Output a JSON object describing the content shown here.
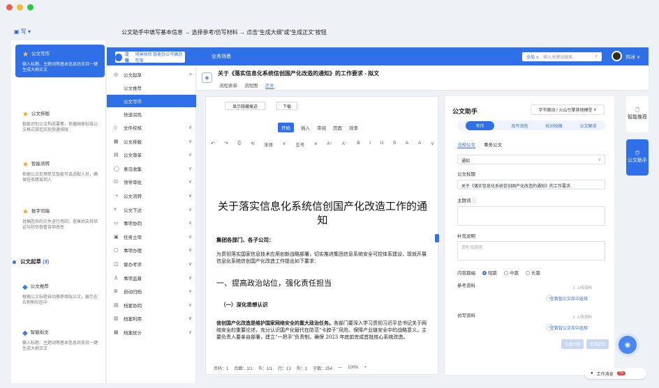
{
  "window": {
    "traffic": [
      "#ef5b52",
      "#f5bd2d",
      "#28c840"
    ]
  },
  "tip": "公文助手中填写基本信息 → 选择参考/仿写材料 → 点击“生成大纲”或“生成正文”按钮",
  "workspace": "写",
  "left_cards": [
    {
      "title": "公文写作",
      "desc": "输入标题、主题词等基本信息后支持一键生成大纲正文",
      "icon": "star-icon",
      "sel": true
    },
    {
      "title": "公文排版",
      "desc": "智能识别公文构成要素，依据国家标准公文格式规范实现快速排版",
      "icon": "star-icon"
    },
    {
      "title": "智能流转",
      "desc": "依据公文处理意见智能写选适配人员，确保任务精准到人",
      "icon": "star-icon"
    },
    {
      "title": "数字司稿",
      "desc": "对稿签后的文件进行用印，查章后支持验证与防伪查看各项改性",
      "icon": "star-icon"
    },
    {
      "title": "公文推荐",
      "desc": "根据公文标题自动推荐相似公文，展示在右侧侧栏区中",
      "icon": "drop-icon"
    },
    {
      "title": "智能拟文",
      "desc": "输入标题、主题词等基本信息后支持一键生成大纲正文",
      "icon": "drop-icon"
    }
  ],
  "section": {
    "label": "公文起草",
    "count": "(3)"
  },
  "topbar": {
    "logo": "泛微",
    "logo_sub": "场景体验 智能办公写稿办存审",
    "tab": "业务场景",
    "search_scope": "全局 ∨",
    "search_placeholder": "输入关键词搜索",
    "user": "刘冰 ∨"
  },
  "nav": [
    {
      "label": "公文起草",
      "icon": "◎",
      "ch": ">"
    },
    {
      "label": "公文推荐",
      "sub": true
    },
    {
      "label": "公文写作",
      "sub": true,
      "act": true
    },
    {
      "label": "快速润色",
      "sub": true
    },
    {
      "label": "文件校核",
      "icon": "◇",
      "ch": "∨"
    },
    {
      "label": "公文排版",
      "icon": "▦",
      "ch": "∨"
    },
    {
      "label": "公文审单",
      "icon": "▤",
      "ch": "∨"
    },
    {
      "label": "意见收集",
      "icon": "◯",
      "ch": "∨"
    },
    {
      "label": "领导审批",
      "icon": "☑",
      "ch": "∨"
    },
    {
      "label": "公文流转",
      "icon": "⇢",
      "ch": "∨"
    },
    {
      "label": "公文下达",
      "icon": "⩔",
      "ch": "∨"
    },
    {
      "label": "事项协同",
      "icon": "▭",
      "ch": "∨"
    },
    {
      "label": "任务立项",
      "icon": "▣",
      "ch": "∨"
    },
    {
      "label": "事项办理",
      "icon": "▢",
      "ch": "∨"
    },
    {
      "label": "督办考评",
      "icon": "◫",
      "ch": "∨"
    },
    {
      "label": "事项监督",
      "icon": "♙",
      "ch": "∨"
    },
    {
      "label": "自动归档",
      "icon": "⊞",
      "ch": "∨"
    },
    {
      "label": "档案协同",
      "icon": "▤",
      "ch": "∨"
    },
    {
      "label": "档案利用",
      "icon": "▥",
      "ch": "∨"
    },
    {
      "label": "档案统计",
      "icon": "▦",
      "ch": "∨"
    }
  ],
  "doc": {
    "title": "关于《落实信息化系统信创国产化改造的通知》的工作要求 - 拟文",
    "tabs": [
      "流程表单",
      "流程图",
      "正文"
    ]
  },
  "editor": {
    "btn1": "显示隐藏痕迹",
    "btn2": "下载",
    "ribbon": [
      "开始",
      "插入",
      "审阅",
      "页面",
      "效率"
    ],
    "fmt": [
      "↶",
      "↷",
      "⎙",
      "⟲",
      "宋体",
      "∨",
      "五号",
      "∨",
      "A⁺",
      "A⁻",
      "B",
      "I",
      "U",
      "S",
      "A",
      "A",
      "∨"
    ],
    "title": "关于落实信息化系统信创国产化改造工作的通知",
    "to": "集团各部门、各子公司：",
    "intro": "为贯彻落实国家信息技术应用创新战略部署，切实推进集团信息系统安全可控体系建设，现就开展信息化系统信创国产化改造工作提出如下要求：",
    "h1": "一、提高政治站位，强化责任担当",
    "h2": "（一）深化思想认识",
    "body_b": "信创国产化改造是维护国家网络安全的重大政治任务。",
    "body": "各部门要深入学习贯彻习近平总书记关于网络安全的重要论述，充分认识国产化替代在防范“卡脖子”风险、保障产业链安全中的战略意义。主要负责人要亲自部署，建立“一把手”负责制，确保 2023 年底前完成首批核心系统改造。",
    "status": [
      "页码：1",
      "页面：1/1",
      "节：1/1",
      "行：13",
      "列：1",
      "字数：254",
      "—",
      "100%",
      "+"
    ]
  },
  "assist": {
    "title": "公文助手",
    "model": "字节跳动 / 火山引擎其他模型",
    "tabs": [
      "写作",
      "改写润色",
      "校对校稿",
      "公文解读"
    ],
    "subtabs": [
      "法规公文",
      "事务公文"
    ],
    "doctype": "通知",
    "label_title": "公文标题",
    "title_value": "关于《落实信息化系统信创国产化改造的通知》的工作要求",
    "label_topic": "主题词",
    "label_note": "补充说明",
    "note_ph": "请补充说明",
    "label_len": "内容篇幅",
    "len_opts": [
      "短篇",
      "中篇",
      "长篇"
    ],
    "label_ref": "参考资料",
    "upload": "上传资料",
    "pick": "在数智公文库中选择",
    "label_copy": "仿写资料",
    "gen_outline": "生成大纲",
    "gen_body": "生成正文"
  },
  "rail": [
    {
      "label": "智能推荐",
      "icon": "file-icon"
    },
    {
      "label": "公文助手",
      "icon": "doc-icon",
      "act": true
    }
  ],
  "work_msg": "工作消息",
  "work_count": "75"
}
